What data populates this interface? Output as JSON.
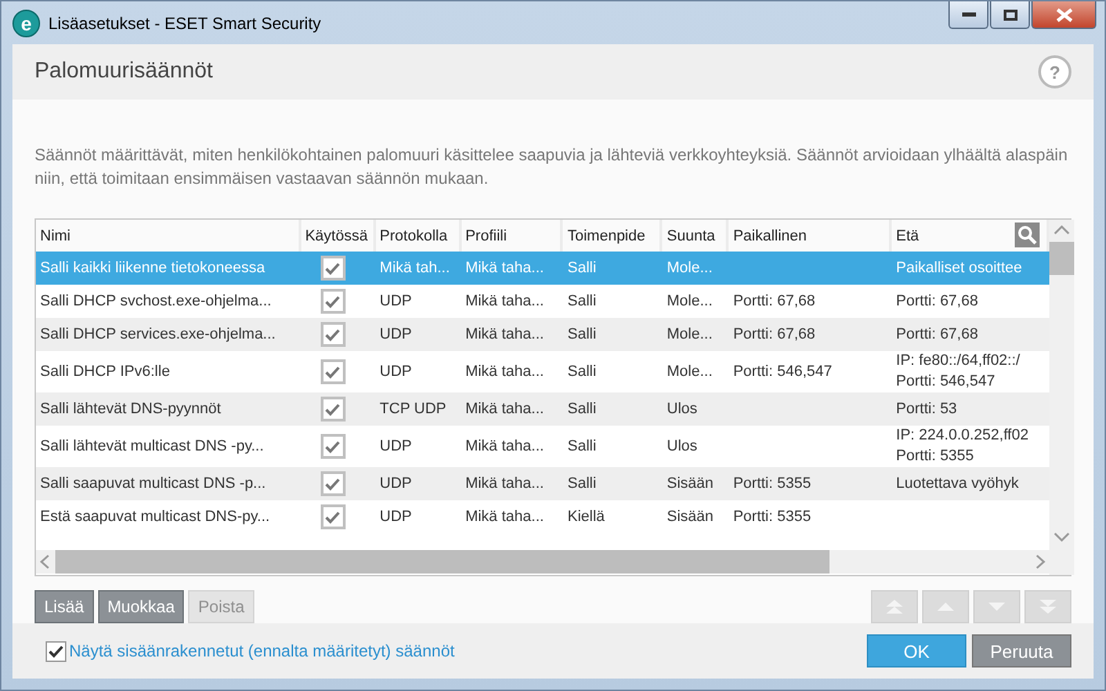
{
  "window": {
    "app_icon": "e",
    "title": "Lisäasetukset - ESET Smart Security"
  },
  "header": {
    "title": "Palomuurisäännöt",
    "help": "?"
  },
  "description": "Säännöt määrittävät, miten henkilökohtainen palomuuri käsittelee saapuvia ja lähteviä verkkoyhteyksiä. Säännöt arvioidaan ylhäältä alaspäin niin, että toimitaan ensimmäisen vastaavan säännön mukaan.",
  "table": {
    "columns": [
      "Nimi",
      "Käytössä",
      "Protokolla",
      "Profiili",
      "Toimenpide",
      "Suunta",
      "Paikallinen",
      "Etä"
    ],
    "rows": [
      {
        "name": "Salli kaikki liikenne tietokoneessa",
        "enabled": true,
        "protocol": "Mikä tah...",
        "profile": "Mikä taha...",
        "action": "Salli",
        "direction": "Mole...",
        "local": "",
        "remote": "Paikalliset osoittee",
        "selected": true
      },
      {
        "name": "Salli DHCP svchost.exe-ohjelma...",
        "enabled": true,
        "protocol": "UDP",
        "profile": "Mikä taha...",
        "action": "Salli",
        "direction": "Mole...",
        "local": "Portti: 67,68",
        "remote": "Portti: 67,68",
        "selected": false
      },
      {
        "name": "Salli DHCP services.exe-ohjelma...",
        "enabled": true,
        "protocol": "UDP",
        "profile": "Mikä taha...",
        "action": "Salli",
        "direction": "Mole...",
        "local": "Portti: 67,68",
        "remote": "Portti: 67,68",
        "selected": false
      },
      {
        "name": "Salli DHCP IPv6:lle",
        "enabled": true,
        "protocol": "UDP",
        "profile": "Mikä taha...",
        "action": "Salli",
        "direction": "Mole...",
        "local": "Portti: 546,547",
        "remote": "IP: fe80::/64,ff02::/\nPortti: 546,547",
        "selected": false
      },
      {
        "name": "Salli lähtevät DNS-pyynnöt",
        "enabled": true,
        "protocol": "TCP UDP",
        "profile": "Mikä taha...",
        "action": "Salli",
        "direction": "Ulos",
        "local": "",
        "remote": "Portti: 53",
        "selected": false
      },
      {
        "name": "Salli lähtevät multicast DNS -py...",
        "enabled": true,
        "protocol": "UDP",
        "profile": "Mikä taha...",
        "action": "Salli",
        "direction": "Ulos",
        "local": "",
        "remote": "IP: 224.0.0.252,ff02\nPortti: 5355",
        "selected": false
      },
      {
        "name": "Salli saapuvat multicast DNS -p...",
        "enabled": true,
        "protocol": "UDP",
        "profile": "Mikä taha...",
        "action": "Salli",
        "direction": "Sisään",
        "local": "Portti: 5355",
        "remote": "Luotettava vyöhyk",
        "selected": false
      },
      {
        "name": "Estä saapuvat multicast DNS-py...",
        "enabled": true,
        "protocol": "UDP",
        "profile": "Mikä taha...",
        "action": "Kiellä",
        "direction": "Sisään",
        "local": "Portti: 5355",
        "remote": "",
        "selected": false
      }
    ]
  },
  "actions": [
    {
      "label": "Lisää",
      "disabled": false
    },
    {
      "label": "Muokkaa",
      "disabled": false
    },
    {
      "label": "Poista",
      "disabled": true
    }
  ],
  "move_buttons": [
    {
      "kind": "top",
      "disabled": true
    },
    {
      "kind": "up",
      "disabled": true
    },
    {
      "kind": "down",
      "disabled": true
    },
    {
      "kind": "bottom",
      "disabled": true
    }
  ],
  "show_builtin": {
    "label": "Näytä sisäänrakennetut (ennalta määritetyt) säännöt",
    "checked": true
  },
  "footer_buttons": [
    {
      "label": "OK",
      "kind": "primary"
    },
    {
      "label": "Peruuta",
      "kind": "secondary"
    }
  ]
}
